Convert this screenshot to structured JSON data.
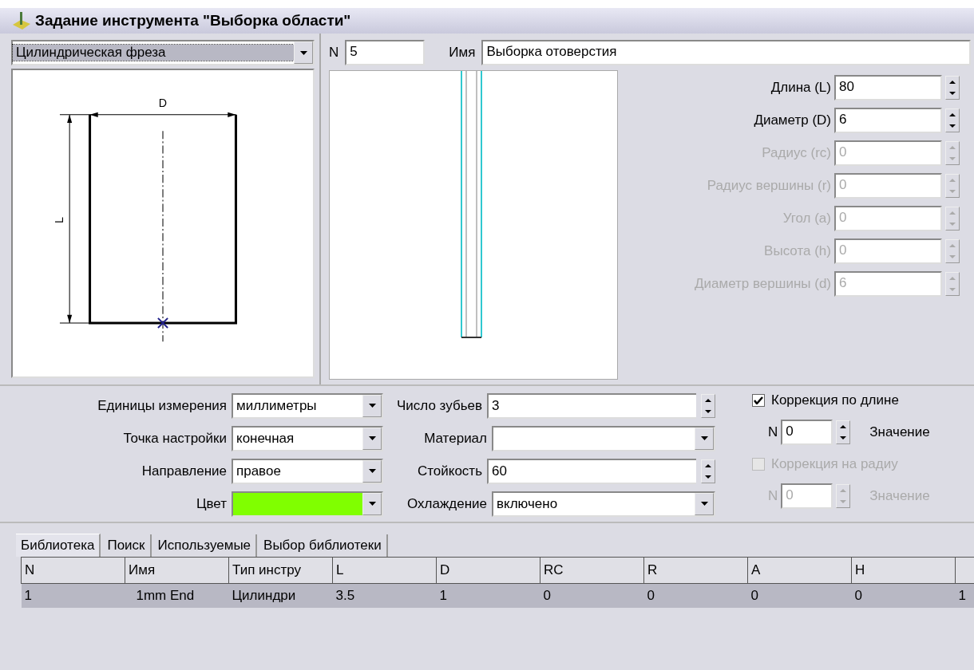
{
  "window": {
    "title": "Задание инструмента \"Выборка области\""
  },
  "tool_type": {
    "value": "Цилиндрическая фреза"
  },
  "diagram": {
    "width_label": "D",
    "length_label": "L"
  },
  "number": {
    "label": "N",
    "value": "5"
  },
  "name": {
    "label": "Имя",
    "value": "Выборка отоверстия"
  },
  "params": [
    {
      "label": "Длина (L)",
      "value": "80",
      "disabled": false
    },
    {
      "label": "Диаметр (D)",
      "value": "6",
      "disabled": false
    },
    {
      "label": "Радиус (rc)",
      "value": "0",
      "disabled": true
    },
    {
      "label": "Радиус вершины (r)",
      "value": "0",
      "disabled": true
    },
    {
      "label": "Угол (a)",
      "value": "0",
      "disabled": true
    },
    {
      "label": "Высота (h)",
      "value": "0",
      "disabled": true
    },
    {
      "label": "Диаметр вершины (d)",
      "value": "6",
      "disabled": true
    }
  ],
  "settings": [
    {
      "label": "Единицы измерения",
      "kind": "combo",
      "value": "миллиметры"
    },
    {
      "label": "Точка настройки",
      "kind": "combo",
      "value": "конечная"
    },
    {
      "label": "Направление",
      "kind": "combo",
      "value": "правое"
    },
    {
      "label": "Цвет",
      "kind": "color",
      "color": "#80ff00"
    }
  ],
  "tool_settings": [
    {
      "label": "Число зубьев",
      "kind": "spin",
      "value": "3"
    },
    {
      "label": "Материал",
      "kind": "combo"
    },
    {
      "label": "Стойкость",
      "kind": "spin",
      "value": "60"
    },
    {
      "label": "Охлаждение",
      "kind": "combo",
      "value": "включено"
    }
  ],
  "corrections": [
    {
      "label": "Коррекция по длине",
      "checked": true,
      "disabled": false,
      "n_label": "N",
      "n_value": "0",
      "value_label": "Значение"
    },
    {
      "label": "Коррекция на радиу",
      "checked": false,
      "disabled": true,
      "n_label": "N",
      "n_value": "0",
      "value_label": "Значение"
    }
  ],
  "tabs": [
    {
      "label": "Библиотека",
      "selected": true
    },
    {
      "label": "Поиск",
      "selected": false
    },
    {
      "label": "Используемые",
      "selected": false
    },
    {
      "label": "Выбор библиотеки",
      "selected": false
    }
  ],
  "table": {
    "columns": [
      "N",
      "Имя",
      "Тип инстру",
      "L",
      "D",
      "RC",
      "R",
      "A",
      "H"
    ],
    "rows": [
      {
        "selected": true,
        "cells": [
          "1",
          "1mm End",
          "Цилиндри",
          "3.5",
          "1",
          "0",
          "0",
          "0",
          "0",
          "1"
        ]
      }
    ]
  }
}
